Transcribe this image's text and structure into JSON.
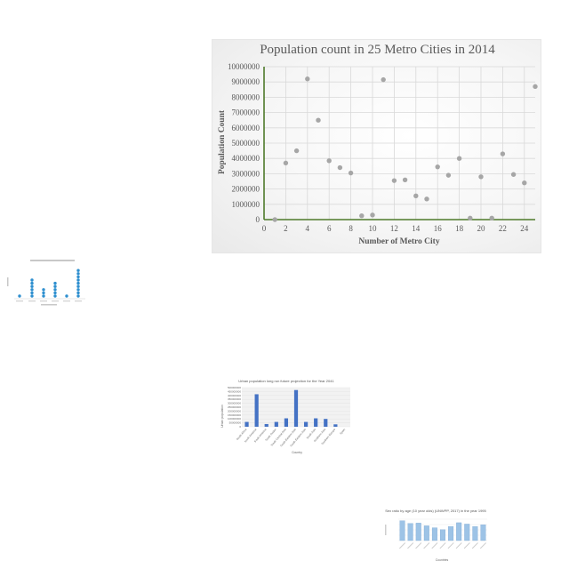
{
  "chart_data": [
    {
      "type": "scatter",
      "title": "Population count in 25 Metro Cities in 2014",
      "xlabel": "Number of Metro City",
      "ylabel": "Population Count",
      "xlim": [
        0,
        25
      ],
      "ylim": [
        0,
        10000000
      ],
      "x_ticks": [
        "0",
        "2",
        "4",
        "6",
        "8",
        "10",
        "12",
        "14",
        "16",
        "18",
        "20",
        "22",
        "24"
      ],
      "y_ticks": [
        "0",
        "1000000",
        "2000000",
        "3000000",
        "4000000",
        "5000000",
        "6000000",
        "7000000",
        "8000000",
        "9000000",
        "10000000"
      ],
      "grid": true,
      "color": "#a6a6a6",
      "axis_color": "#4e7a2a",
      "points": [
        {
          "x": 1,
          "y": 0
        },
        {
          "x": 2,
          "y": 3700000
        },
        {
          "x": 3,
          "y": 4500000
        },
        {
          "x": 4,
          "y": 9200000
        },
        {
          "x": 5,
          "y": 6500000
        },
        {
          "x": 6,
          "y": 3850000
        },
        {
          "x": 7,
          "y": 3400000
        },
        {
          "x": 8,
          "y": 3050000
        },
        {
          "x": 9,
          "y": 250000
        },
        {
          "x": 10,
          "y": 300000
        },
        {
          "x": 11,
          "y": 9150000
        },
        {
          "x": 12,
          "y": 2550000
        },
        {
          "x": 13,
          "y": 2600000
        },
        {
          "x": 14,
          "y": 1550000
        },
        {
          "x": 15,
          "y": 1350000
        },
        {
          "x": 16,
          "y": 3450000
        },
        {
          "x": 17,
          "y": 2900000
        },
        {
          "x": 18,
          "y": 4000000
        },
        {
          "x": 19,
          "y": 100000
        },
        {
          "x": 20,
          "y": 2800000
        },
        {
          "x": 21,
          "y": 100000
        },
        {
          "x": 22,
          "y": 4300000
        },
        {
          "x": 23,
          "y": 2950000
        },
        {
          "x": 24,
          "y": 2400000
        },
        {
          "x": 25,
          "y": 8700000
        }
      ]
    },
    {
      "type": "scatter",
      "title": "",
      "xlabel": "",
      "ylabel": "",
      "color": "#2e8fcf",
      "note": "dot-stack plot, text too small to read",
      "columns": [
        1,
        6,
        3,
        5,
        1,
        9
      ]
    },
    {
      "type": "bar",
      "title": "Urban population long run future projection for the Year 2041",
      "xlabel": "Country",
      "ylabel": "Urban population",
      "color": "#4472c4",
      "categories": [
        "South Africa",
        "North America",
        "South America",
        "South Sudan",
        "South Central Asia",
        "South-Eastern Asia",
        "South Eastern Asia",
        "South Asia",
        "Southern Asia",
        "Southern Europe",
        "Spain"
      ],
      "values": [
        80000000,
        540000000,
        45000000,
        80000000,
        140000000,
        610000000,
        80000000,
        140000000,
        130000000,
        40000000,
        0
      ],
      "y_ticks": [
        "0",
        "50000000",
        "100000000",
        "150000000",
        "200000000",
        "250000000",
        "300000000",
        "350000000",
        "400000000",
        "450000000",
        "500000000"
      ]
    },
    {
      "type": "bar",
      "title": "Sex ratio by age (10 year olds) (UNWPP, 2017) in the year 1995",
      "xlabel": "Countries",
      "ylabel": "",
      "color": "#9dc3e6",
      "categories": [
        "",
        "",
        "",
        "",
        "",
        "",
        "",
        "",
        "",
        "",
        ""
      ],
      "values": [
        1.02,
        0.88,
        0.9,
        0.76,
        0.66,
        0.56,
        0.72,
        0.92,
        0.85,
        0.72,
        0.81
      ]
    }
  ]
}
